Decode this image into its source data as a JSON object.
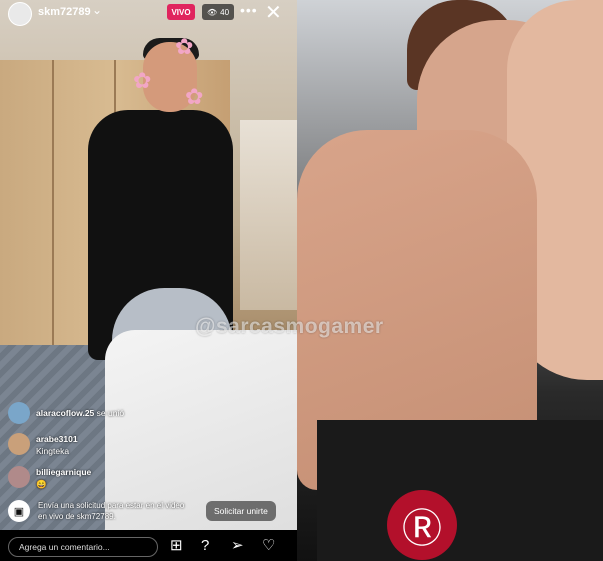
{
  "header": {
    "username": "skm72789",
    "live_label": "VIVO",
    "viewer_count": "40"
  },
  "watermark": "@sarcasmogamer",
  "comments": [
    {
      "user": "alaracoflow.25",
      "text": "se unió"
    },
    {
      "user": "arabe3101",
      "text": "Kingteka"
    },
    {
      "user": "billiegarnique",
      "text": "😄"
    }
  ],
  "join_request": {
    "message": "Envía una solicitud para estar en el video en vivo de skm72789.",
    "button_label": "Solicitar unirte"
  },
  "bottom_bar": {
    "comment_placeholder": "Agrega un comentario..."
  },
  "right_pane": {
    "shirt_logo": "Ⓡ"
  }
}
